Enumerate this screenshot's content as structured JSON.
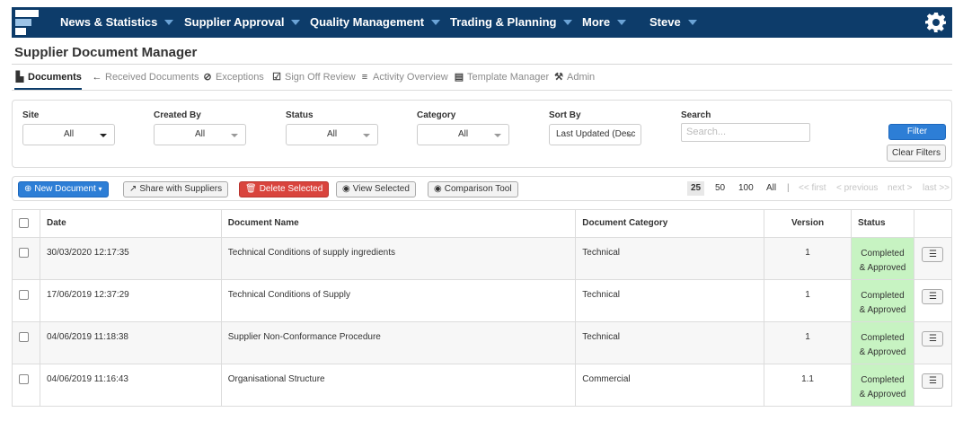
{
  "nav": {
    "items": [
      {
        "label": "News & Statistics"
      },
      {
        "label": "Supplier Approval"
      },
      {
        "label": "Quality Management"
      },
      {
        "label": "Trading & Planning"
      },
      {
        "label": "More"
      },
      {
        "label": "Steve"
      }
    ],
    "icons": {
      "logo": "logo-icon",
      "settings": "gear-icon",
      "caret": "chevron-down-icon"
    }
  },
  "page": {
    "title": "Supplier Document Manager"
  },
  "tabs": [
    {
      "label": "Documents",
      "icon": "document-icon",
      "active": true
    },
    {
      "label": "Received Documents",
      "icon": "arrow-left-icon"
    },
    {
      "label": "Exceptions",
      "icon": "check-circle-icon"
    },
    {
      "label": "Sign Off Review",
      "icon": "edit-check-icon"
    },
    {
      "label": "Activity Overview",
      "icon": "list-icon"
    },
    {
      "label": "Template Manager",
      "icon": "table-icon"
    },
    {
      "label": "Admin",
      "icon": "wrench-icon"
    }
  ],
  "filters": {
    "site": {
      "label": "Site",
      "value": "All"
    },
    "created_by": {
      "label": "Created By",
      "value": "All"
    },
    "status": {
      "label": "Status",
      "value": "All"
    },
    "category": {
      "label": "Category",
      "value": "All"
    },
    "sort_by": {
      "label": "Sort By",
      "value": "Last Updated (Desc"
    },
    "search": {
      "label": "Search",
      "placeholder": "Search..."
    },
    "filter_label": "Filter",
    "clear_label": "Clear Filters"
  },
  "toolbar": {
    "new_document": "New Document",
    "share": "Share with Suppliers",
    "delete": "Delete Selected",
    "view": "View Selected",
    "compare": "Comparison Tool",
    "page_sizes": [
      "25",
      "50",
      "100",
      "All"
    ],
    "separator": "|",
    "first": "<< first",
    "previous": "< previous",
    "next": "next >",
    "last": "last >>"
  },
  "table": {
    "headers": {
      "date": "Date",
      "name": "Document Name",
      "category": "Document Category",
      "version": "Version",
      "status": "Status"
    },
    "rows": [
      {
        "date": "30/03/2020 12:17:35",
        "name": "Technical Conditions of supply ingredients",
        "category": "Technical",
        "version": "1",
        "status_line1": "Completed",
        "status_line2": "& Approved"
      },
      {
        "date": "17/06/2019 12:37:29",
        "name": "Technical Conditions of Supply",
        "category": "Technical",
        "version": "1",
        "status_line1": "Completed",
        "status_line2": "& Approved"
      },
      {
        "date": "04/06/2019 11:18:38",
        "name": "Supplier Non-Conformance Procedure",
        "category": "Technical",
        "version": "1",
        "status_line1": "Completed",
        "status_line2": "& Approved"
      },
      {
        "date": "04/06/2019 11:16:43",
        "name": "Organisational Structure",
        "category": "Commercial",
        "version": "1.1",
        "status_line1": "Completed",
        "status_line2": "& Approved"
      }
    ]
  },
  "colors": {
    "nav_bg": "#0d3c6a",
    "primary": "#2d7ed6",
    "danger": "#d9443d",
    "status_ok": "#c7f3c2"
  }
}
